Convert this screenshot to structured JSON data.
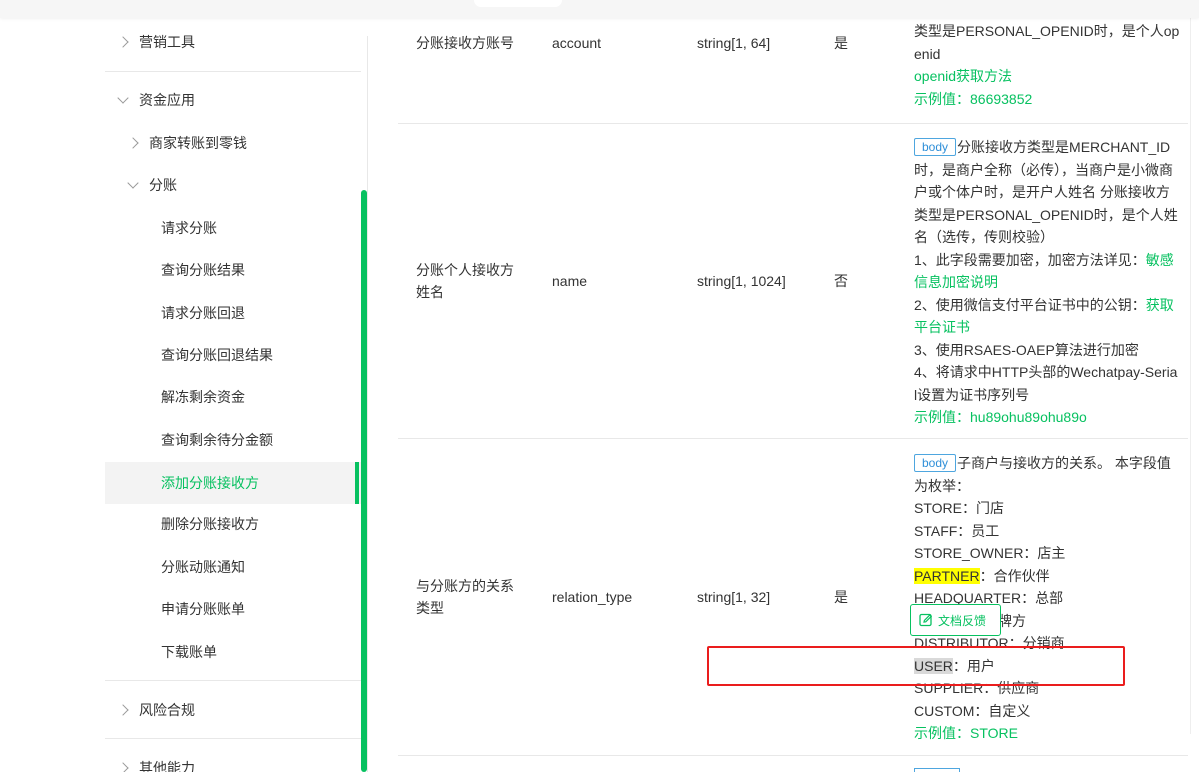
{
  "sidebar": {
    "marketing": "营销工具",
    "funds": "资金应用",
    "transfer": "商家转账到零钱",
    "split": "分账",
    "items": [
      "请求分账",
      "查询分账结果",
      "请求分账回退",
      "查询分账回退结果",
      "解冻剩余资金",
      "查询剩余待分金额",
      "添加分账接收方",
      "删除分账接收方",
      "分账动账通知",
      "申请分账账单",
      "下载账单"
    ],
    "risk": "风险合规",
    "other": "其他能力"
  },
  "rows": [
    {
      "name": "分账接收方账号",
      "field": "account",
      "type": "string[1, 64]",
      "required": "是",
      "desc": [
        "类型是PERSONAL_OPENID时，是个人op",
        "enid"
      ],
      "link": "openid获取方法",
      "example": "示例值：86693852"
    },
    {
      "name1": "分账个人接收方",
      "name2": "姓名",
      "field": "name",
      "type": "string[1, 1024]",
      "required": "否",
      "tag": "body",
      "desc_first": "分账接收方类型是MERCHANT_ID",
      "desc": [
        "时，是商户全称（必传），当商户是小微商",
        "户或个体户时，是开户人姓名 分账接收方",
        "类型是PERSONAL_OPENID时，是个人姓",
        "名（选传，传则校验）"
      ],
      "note1": "1、此字段需要加密，加密方法详见：",
      "note1_link_a": "敏感",
      "note1_link_b": "信息加密说明",
      "note2": "2、使用微信支付平台证书中的公钥：",
      "note2_link_a": "获取",
      "note2_link_b": "平台证书",
      "note3": "3、使用RSAES-OAEP算法进行加密",
      "note4_a": "4、将请求中HTTP头部的Wechatpay-Seria",
      "note4_b": "l设置为证书序列号",
      "example": "示例值：hu89ohu89ohu89o"
    },
    {
      "name1": "与分账方的关系",
      "name2": "类型",
      "field": "relation_type",
      "type": "string[1, 32]",
      "required": "是",
      "tag": "body",
      "desc_first": "子商户与接收方的关系。 本字段值",
      "desc_second": "为枚举：",
      "enum": {
        "store": "STORE：门店",
        "staff": "STAFF：员工",
        "owner": "STORE_OWNER：店主",
        "partner_key": "PARTNER",
        "partner_val": "：合作伙伴",
        "hq": "HEADQUARTER：总部",
        "brand_tail": "牌方",
        "distributor": "DISTRIBUTOR：分销商",
        "user_key": "USER",
        "user_val": "：用户",
        "supplier": "SUPPLIER：供应商",
        "custom": "CUSTOM：自定义"
      },
      "example": "示例值：STORE"
    }
  ],
  "feedback": "文档反馈"
}
